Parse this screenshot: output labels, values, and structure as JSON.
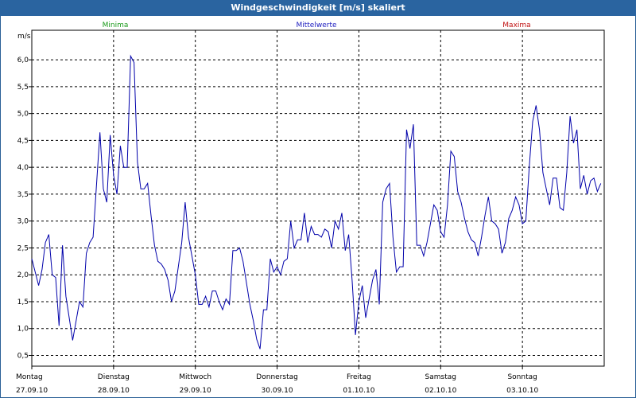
{
  "chart_data": {
    "type": "line",
    "title": "Windgeschwindigkeit [m/s] skaliert",
    "ylabel": "m/s",
    "ylim": [
      0.3,
      6.55
    ],
    "xlim": [
      0,
      168
    ],
    "yticks": [
      0.5,
      1.0,
      1.5,
      2.0,
      2.5,
      3.0,
      3.5,
      4.0,
      4.5,
      5.0,
      5.5,
      6.0
    ],
    "ytick_labels": [
      "0,5",
      "1,0",
      "1,5",
      "2,0",
      "2,5",
      "3,0",
      "3,5",
      "4,0",
      "4,5",
      "5,0",
      "5,5",
      "6,0"
    ],
    "legend": [
      {
        "label": "Minima",
        "color": "#1a9a1a"
      },
      {
        "label": "Mittelwerte",
        "color": "#2020c0"
      },
      {
        "label": "Maxima",
        "color": "#c01010"
      }
    ],
    "day_labels": [
      {
        "day": "Montag",
        "date": "27.09.10"
      },
      {
        "day": "Dienstag",
        "date": "28.09.10"
      },
      {
        "day": "Mittwoch",
        "date": "29.09.10"
      },
      {
        "day": "Donnerstag",
        "date": "30.09.10"
      },
      {
        "day": "Freitag",
        "date": "01.10.10"
      },
      {
        "day": "Samstag",
        "date": "02.10.10"
      },
      {
        "day": "Sonntag",
        "date": "03.10.10"
      }
    ],
    "grid": true,
    "series": [
      {
        "name": "Mittelwerte",
        "color": "#0000aa",
        "points": [
          [
            0,
            2.3
          ],
          [
            2,
            1.8
          ],
          [
            3,
            2.1
          ],
          [
            4,
            2.6
          ],
          [
            5,
            2.75
          ],
          [
            6,
            2.0
          ],
          [
            7,
            1.95
          ],
          [
            8,
            1.05
          ],
          [
            9,
            2.55
          ],
          [
            10,
            1.6
          ],
          [
            12,
            0.78
          ],
          [
            14,
            1.5
          ],
          [
            15,
            1.4
          ],
          [
            16,
            2.4
          ],
          [
            17,
            2.6
          ],
          [
            18,
            2.7
          ],
          [
            20,
            4.65
          ],
          [
            21,
            3.6
          ],
          [
            22,
            3.35
          ],
          [
            23,
            4.6
          ],
          [
            24,
            3.85
          ],
          [
            25,
            3.5
          ],
          [
            26,
            4.4
          ],
          [
            27,
            4.0
          ],
          [
            28,
            4.0
          ],
          [
            29,
            6.07
          ],
          [
            30,
            5.95
          ],
          [
            31,
            4.1
          ],
          [
            32,
            3.6
          ],
          [
            33,
            3.6
          ],
          [
            34,
            3.7
          ],
          [
            35,
            3.1
          ],
          [
            36,
            2.55
          ],
          [
            37,
            2.25
          ],
          [
            38,
            2.2
          ],
          [
            39,
            2.1
          ],
          [
            40,
            1.9
          ],
          [
            41,
            1.5
          ],
          [
            42,
            1.7
          ],
          [
            43,
            2.15
          ],
          [
            44,
            2.6
          ],
          [
            45,
            3.35
          ],
          [
            46,
            2.7
          ],
          [
            47,
            2.35
          ],
          [
            48,
            2.0
          ],
          [
            49,
            1.45
          ],
          [
            50,
            1.45
          ],
          [
            51,
            1.6
          ],
          [
            52,
            1.4
          ],
          [
            53,
            1.7
          ],
          [
            54,
            1.7
          ],
          [
            55,
            1.5
          ],
          [
            56,
            1.35
          ],
          [
            57,
            1.55
          ],
          [
            58,
            1.45
          ],
          [
            59,
            2.45
          ],
          [
            60,
            2.45
          ],
          [
            61,
            2.5
          ],
          [
            62,
            2.25
          ],
          [
            63,
            1.85
          ],
          [
            64,
            1.45
          ],
          [
            65,
            1.15
          ],
          [
            66,
            0.8
          ],
          [
            67,
            0.62
          ],
          [
            68,
            1.35
          ],
          [
            69,
            1.35
          ],
          [
            70,
            2.3
          ],
          [
            71,
            2.05
          ],
          [
            72,
            2.15
          ],
          [
            73,
            2.0
          ],
          [
            74,
            2.25
          ],
          [
            75,
            2.3
          ],
          [
            76,
            3.0
          ],
          [
            77,
            2.5
          ],
          [
            78,
            2.65
          ],
          [
            79,
            2.65
          ],
          [
            80,
            3.15
          ],
          [
            81,
            2.6
          ],
          [
            82,
            2.9
          ],
          [
            83,
            2.75
          ],
          [
            84,
            2.75
          ],
          [
            85,
            2.7
          ],
          [
            86,
            2.85
          ],
          [
            87,
            2.8
          ],
          [
            88,
            2.5
          ],
          [
            89,
            3.0
          ],
          [
            90,
            2.85
          ],
          [
            91,
            3.15
          ],
          [
            92,
            2.45
          ],
          [
            93,
            2.75
          ],
          [
            94,
            1.9
          ],
          [
            95,
            0.88
          ],
          [
            96,
            1.5
          ],
          [
            97,
            1.8
          ],
          [
            98,
            1.2
          ],
          [
            99,
            1.55
          ],
          [
            100,
            1.9
          ],
          [
            101,
            2.1
          ],
          [
            102,
            1.45
          ],
          [
            103,
            3.35
          ],
          [
            104,
            3.6
          ],
          [
            105,
            3.7
          ],
          [
            106,
            2.7
          ],
          [
            107,
            2.05
          ],
          [
            108,
            2.15
          ],
          [
            109,
            2.15
          ],
          [
            110,
            4.7
          ],
          [
            111,
            4.35
          ],
          [
            112,
            4.8
          ],
          [
            113,
            2.55
          ],
          [
            114,
            2.55
          ],
          [
            115,
            2.35
          ],
          [
            116,
            2.6
          ],
          [
            117,
            2.95
          ],
          [
            118,
            3.3
          ],
          [
            119,
            3.2
          ],
          [
            120,
            2.8
          ],
          [
            121,
            2.7
          ],
          [
            122,
            3.3
          ],
          [
            123,
            4.3
          ],
          [
            124,
            4.2
          ],
          [
            125,
            3.55
          ],
          [
            126,
            3.35
          ],
          [
            127,
            3.05
          ],
          [
            128,
            2.8
          ],
          [
            129,
            2.65
          ],
          [
            130,
            2.6
          ],
          [
            131,
            2.35
          ],
          [
            132,
            2.7
          ],
          [
            133,
            3.1
          ],
          [
            134,
            3.45
          ],
          [
            135,
            3.0
          ],
          [
            136,
            2.95
          ],
          [
            137,
            2.85
          ],
          [
            138,
            2.4
          ],
          [
            139,
            2.6
          ],
          [
            140,
            3.05
          ],
          [
            141,
            3.2
          ],
          [
            142,
            3.45
          ],
          [
            143,
            3.3
          ],
          [
            144,
            2.95
          ],
          [
            145,
            3.0
          ],
          [
            146,
            4.0
          ],
          [
            147,
            4.85
          ],
          [
            148,
            5.15
          ],
          [
            149,
            4.7
          ],
          [
            150,
            3.9
          ],
          [
            151,
            3.6
          ],
          [
            152,
            3.3
          ],
          [
            153,
            3.8
          ],
          [
            154,
            3.8
          ],
          [
            155,
            3.25
          ],
          [
            156,
            3.2
          ],
          [
            157,
            3.9
          ],
          [
            158,
            4.95
          ],
          [
            159,
            4.45
          ],
          [
            160,
            4.7
          ],
          [
            161,
            3.6
          ],
          [
            162,
            3.85
          ],
          [
            163,
            3.5
          ],
          [
            164,
            3.75
          ],
          [
            165,
            3.8
          ],
          [
            166,
            3.55
          ],
          [
            167,
            3.7
          ]
        ]
      }
    ]
  }
}
